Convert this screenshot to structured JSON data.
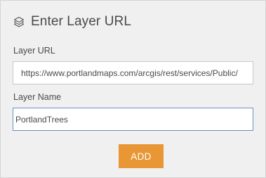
{
  "header": {
    "icon": "layers-icon",
    "title": "Enter Layer URL"
  },
  "layer_url": {
    "label": "Layer URL",
    "value": "https://www.portlandmaps.com/arcgis/rest/services/Public/"
  },
  "layer_name": {
    "label": "Layer Name",
    "value": "PortlandTrees"
  },
  "actions": {
    "add_label": "ADD"
  },
  "colors": {
    "panel_background": "#f0f0f0",
    "add_button": "#e89734",
    "focused_border": "#6b8fc2",
    "text": "#4a4a4a"
  }
}
